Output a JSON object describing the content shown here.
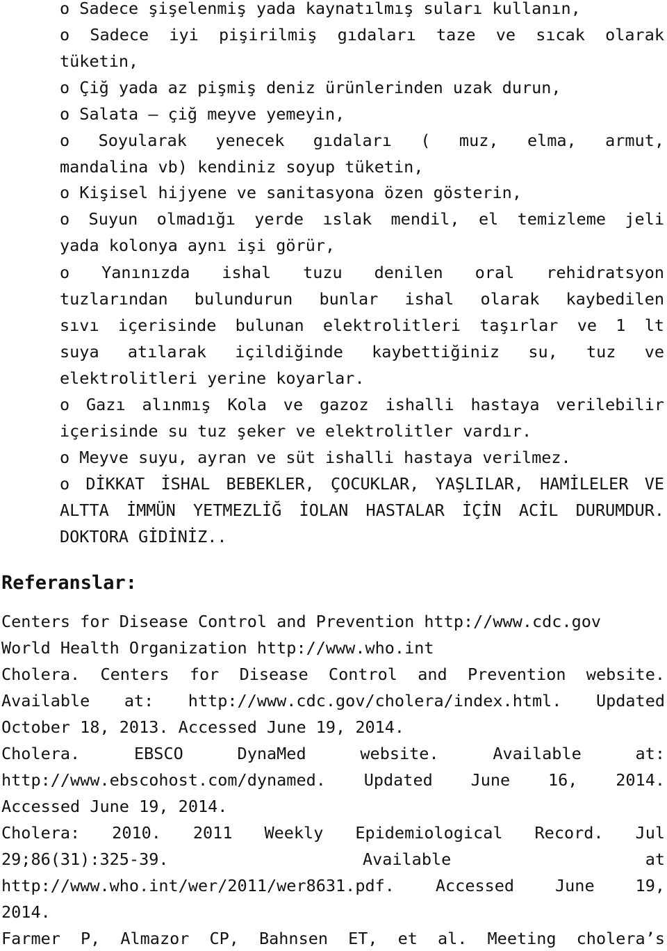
{
  "bullet_list": {
    "items": [
      {
        "marker": "o",
        "lines": [
          "o Sadece şişelenmiş yada kaynatılmış suları kullanın,"
        ]
      },
      {
        "marker": "o",
        "lines": [
          "o Sadece iyi pişirilmiş gıdaları taze ve sıcak olarak",
          "tüketin,"
        ]
      },
      {
        "marker": "o",
        "lines": [
          "o Çiğ yada az pişmiş deniz ürünlerinden uzak durun,"
        ]
      },
      {
        "marker": "o",
        "lines": [
          "o Salata – çiğ meyve yemeyin,"
        ]
      },
      {
        "marker": "o",
        "lines": [
          "o Soyularak yenecek gıdaları ( muz, elma, armut,",
          "mandalina vb) kendiniz soyup tüketin,"
        ]
      },
      {
        "marker": "o",
        "lines": [
          "o Kişisel hijyene ve sanitasyona özen gösterin,"
        ]
      },
      {
        "marker": "o",
        "lines": [
          "o Suyun olmadığı yerde ıslak mendil, el temizleme jeli",
          "yada kolonya aynı işi görür,"
        ]
      },
      {
        "marker": "o",
        "lines": [
          "o Yanınızda ishal tuzu denilen oral rehidratsyon",
          "tuzlarından bulundurun bunlar ishal olarak kaybedilen",
          "sıvı içerisinde bulunan elektrolitleri taşırlar ve 1 lt",
          "suya atılarak içildiğinde kaybettiğiniz su, tuz ve",
          "elektrolitleri yerine koyarlar."
        ]
      },
      {
        "marker": "o",
        "lines": [
          "o Gazı alınmış Kola ve gazoz ishalli hastaya verilebilir",
          "içerisinde su tuz şeker ve elektrolitler vardır."
        ]
      },
      {
        "marker": "o",
        "lines": [
          "o Meyve suyu, ayran ve süt ishalli hastaya verilmez."
        ]
      },
      {
        "marker": "o",
        "lines": [
          "o DİKKAT İSHAL BEBEKLER, ÇOCUKLAR, YAŞLILAR, HAMİLELER VE",
          "ALTTA İMMÜN YETMEZLİĞ İOLAN HASTALAR İÇİN ACİL DURUMDUR.",
          "DOKTORA GİDİNİZ.."
        ]
      }
    ]
  },
  "references": {
    "heading": "Referanslar:",
    "entries": [
      {
        "lines": [
          "Centers for Disease Control and Prevention http://www.cdc.gov"
        ]
      },
      {
        "lines": [
          "World Health Organization http://www.who.int"
        ]
      },
      {
        "lines": [
          "Cholera. Centers for Disease Control and Prevention website.",
          "Available at: http://www.cdc.gov/cholera/index.html. Updated",
          "October 18, 2013. Accessed June 19, 2014."
        ]
      },
      {
        "lines": [
          "Cholera. EBSCO DynaMed website. Available at:",
          "http://www.ebscohost.com/dynamed. Updated June 16, 2014.",
          "Accessed June 19, 2014."
        ]
      },
      {
        "lines": [
          "Cholera: 2010. 2011 Weekly Epidemiological Record. Jul",
          "29;86(31):325-39. Available at",
          "http://www.who.int/wer/2011/wer8631.pdf. Accessed June 19,",
          "2014."
        ]
      },
      {
        "lines": [
          "Farmer P, Almazor CP, Bahnsen ET, et al. Meeting cholera’s"
        ]
      }
    ]
  }
}
